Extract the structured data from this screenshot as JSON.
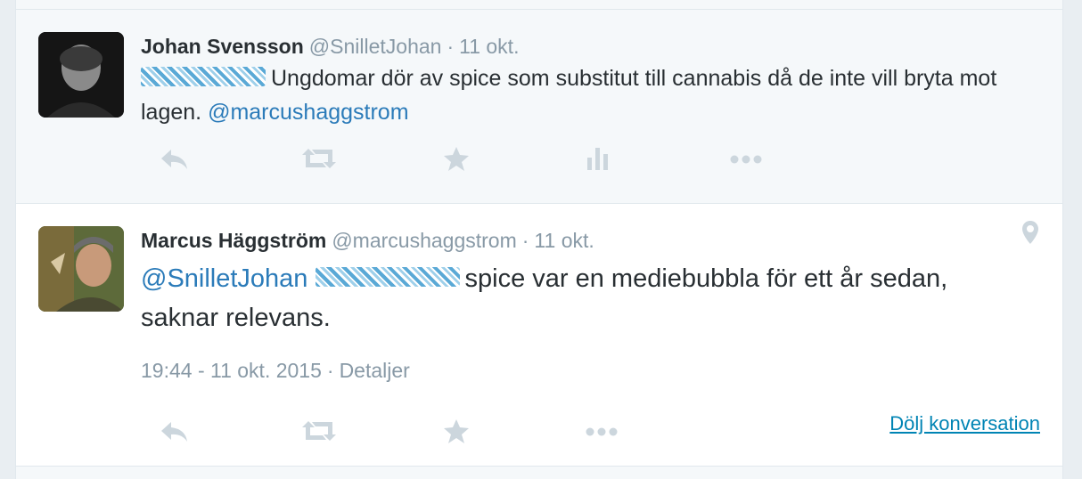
{
  "tweets": [
    {
      "fullname": "Johan Svensson",
      "screen_name": "@SnilletJohan",
      "time": "11 okt.",
      "text": "Ungdomar dör av spice som substitut till cannabis då de inte vill bryta mot lagen.",
      "mention": "@marcushaggstrom"
    },
    {
      "fullname": "Marcus Häggström",
      "screen_name": "@marcushaggstrom",
      "time": "11 okt.",
      "mention": "@SnilletJohan",
      "text": "spice var en mediebubbla för ett år sedan, saknar relevans.",
      "timestamp": "19:44 - 11 okt. 2015",
      "details": "Detaljer",
      "hide_conversation": "Dölj konversation"
    }
  ],
  "separator": "·",
  "icons": {
    "reply": "reply-icon",
    "retweet": "retweet-icon",
    "favorite": "star-icon",
    "analytics": "analytics-icon",
    "more": "more-icon",
    "location": "location-pin-icon"
  },
  "colors": {
    "link": "#2b7bb9",
    "muted": "#8899a6",
    "text": "#292f33",
    "icon": "#ccd6dd"
  }
}
